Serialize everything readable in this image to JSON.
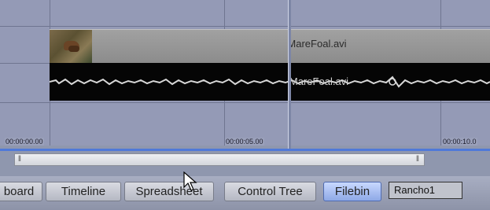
{
  "clip": {
    "video_name": "MareFoal.avi",
    "audio_name": "MareFoal.avi"
  },
  "ruler": {
    "t0": "00:00:00.00",
    "t1": "00:00:05.00",
    "t2": "00:00:10.0"
  },
  "tabs": [
    {
      "label": "board",
      "active": false
    },
    {
      "label": "Timeline",
      "active": false
    },
    {
      "label": "Spreadsheet",
      "active": false
    },
    {
      "label": "Control Tree",
      "active": false
    },
    {
      "label": "Filebin",
      "active": true
    }
  ],
  "project_field": {
    "value": "Rancho1"
  },
  "icons": {
    "cursor": "mouse-pointer-icon",
    "thumbnail": "video-thumbnail-icon",
    "scroll_grip": "scroll-grip-icon"
  },
  "colors": {
    "active_tab": "#8ea9e6",
    "audio_bg": "#050505",
    "timeline_bg": "#949ab6"
  }
}
